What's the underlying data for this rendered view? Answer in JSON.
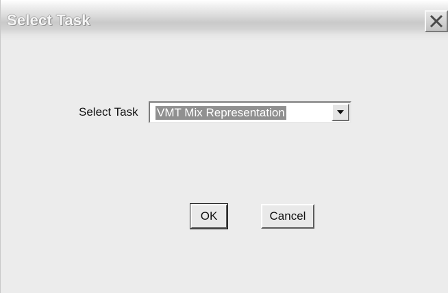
{
  "window": {
    "title": "Select Task",
    "close_icon": "close-icon"
  },
  "form": {
    "task_label": "Select Task",
    "task_select": {
      "selected_value": "VMT Mix Representation",
      "dropdown_icon": "chevron-down-icon"
    }
  },
  "buttons": {
    "ok_label": "OK",
    "cancel_label": "Cancel"
  }
}
